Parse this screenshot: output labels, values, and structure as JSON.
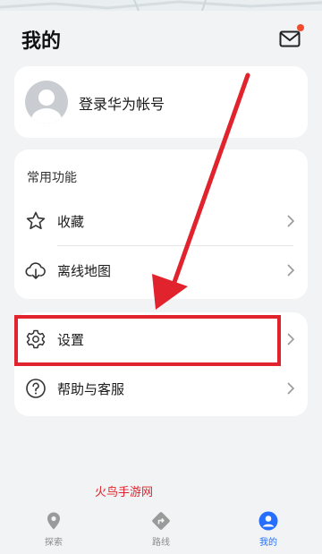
{
  "header": {
    "title": "我的",
    "mail_icon": "mail-icon"
  },
  "profile": {
    "login_text": "登录华为帐号",
    "avatar_icon": "default-avatar-icon"
  },
  "common": {
    "title": "常用功能",
    "items": [
      {
        "label": "收藏",
        "icon": "star-icon"
      },
      {
        "label": "离线地图",
        "icon": "cloud-download-icon"
      }
    ]
  },
  "more": {
    "items": [
      {
        "label": "设置",
        "icon": "gear-icon"
      },
      {
        "label": "帮助与客服",
        "icon": "help-icon"
      }
    ]
  },
  "annotation": {
    "highlight_color": "#e0232c"
  },
  "watermark": "火鸟手游网",
  "nav": {
    "items": [
      {
        "label": "探索",
        "icon": "location-pin-icon",
        "active": false
      },
      {
        "label": "路线",
        "icon": "route-icon",
        "active": false
      },
      {
        "label": "我的",
        "icon": "user-icon",
        "active": true
      }
    ],
    "active_color": "#256fff"
  },
  "colors": {
    "background": "#f1f3f5",
    "card": "#ffffff",
    "accent": "#256fff",
    "notification": "#f04b2c"
  }
}
